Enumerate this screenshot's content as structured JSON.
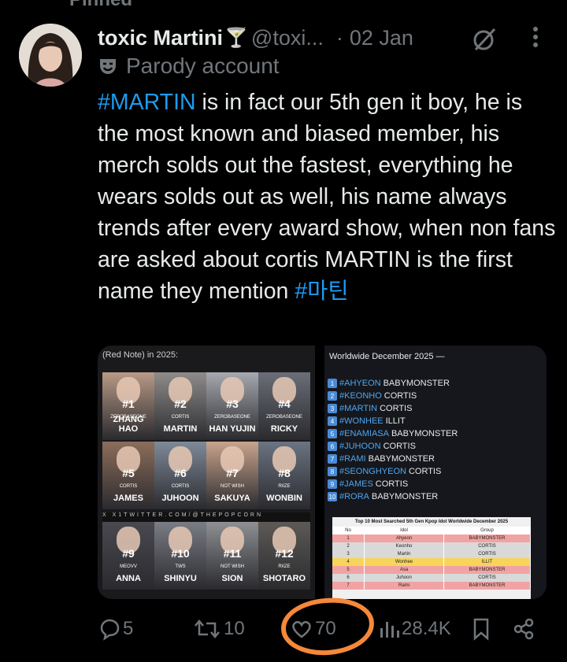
{
  "header_partial": "Pinned",
  "tweet": {
    "author_name": "toxic Martini",
    "author_emoji": "🍸",
    "handle": "@toxi...",
    "separator": "·",
    "date": "02 Jan",
    "parody_label": "Parody account",
    "text_parts": [
      {
        "type": "hashtag",
        "text": "#MARTIN"
      },
      {
        "type": "text",
        "text": " is in fact our 5th gen it boy, he is the most known and biased member, his merch solds out the fastest, everything he wears solds out as well, his name always trends after every award show, when non fans are asked about cortis MARTIN is the first name they mention "
      },
      {
        "type": "hashtag",
        "text": "#마틴"
      }
    ]
  },
  "media_left": {
    "caption": "(Red Note) in 2025:",
    "watermark": "X  X1TWITTER.COM/@THEPOPCORN",
    "cells": [
      {
        "rank": "#1",
        "group": "ZEROBASEONE",
        "idol": "ZHANG HAO",
        "tone": "#b99a86"
      },
      {
        "rank": "#2",
        "group": "CORTIS",
        "idol": "MARTIN",
        "tone": "#8f8c8a"
      },
      {
        "rank": "#3",
        "group": "ZEROBASEONE",
        "idol": "HAN YUJIN",
        "tone": "#a7a9b0"
      },
      {
        "rank": "#4",
        "group": "ZEROBASEONE",
        "idol": "RICKY",
        "tone": "#6a6e78"
      },
      {
        "rank": "#5",
        "group": "CORTIS",
        "idol": "JAMES",
        "tone": "#8d6e5b"
      },
      {
        "rank": "#6",
        "group": "CORTIS",
        "idol": "JUHOON",
        "tone": "#7f8a99"
      },
      {
        "rank": "#7",
        "group": "NOT WISH",
        "idol": "SAKUYA",
        "tone": "#c9a48d"
      },
      {
        "rank": "#8",
        "group": "RIIZE",
        "idol": "WONBIN",
        "tone": "#6b7482"
      },
      {
        "rank": "#9",
        "group": "MEOVV",
        "idol": "ANNA",
        "tone": "#4a4950"
      },
      {
        "rank": "#10",
        "group": "TWS",
        "idol": "SHINYU",
        "tone": "#7b7d85"
      },
      {
        "rank": "#11",
        "group": "NOT WISH",
        "idol": "SION",
        "tone": "#8e9093"
      },
      {
        "rank": "#12",
        "group": "RIIZE",
        "idol": "SHOTARO",
        "tone": "#5d5a56"
      }
    ]
  },
  "media_right": {
    "caption": "Worldwide December 2025 —",
    "ranks": [
      {
        "num": "1",
        "tag": "#AHYEON",
        "group": "BABYMONSTER"
      },
      {
        "num": "2",
        "tag": "#KEONHO",
        "group": "CORTIS"
      },
      {
        "num": "3",
        "tag": "#MARTIN",
        "group": "CORTIS"
      },
      {
        "num": "4",
        "tag": "#WONHEE",
        "group": "ILLIT"
      },
      {
        "num": "5",
        "tag": "#ENAMIASA",
        "group": "BABYMONSTER"
      },
      {
        "num": "6",
        "tag": "#JUHOON",
        "group": "CORTIS"
      },
      {
        "num": "7",
        "tag": "#RAMI",
        "group": "BABYMONSTER"
      },
      {
        "num": "8",
        "tag": "#SEONGHYEON",
        "group": "CORTIS"
      },
      {
        "num": "9",
        "tag": "#JAMES",
        "group": "CORTIS"
      },
      {
        "num": "10",
        "tag": "#RORA",
        "group": "BABYMONSTER"
      }
    ],
    "table": {
      "title": "Top 10 Most Searched 5th Gen Kpop Idol Worldwide December 2025",
      "headers": [
        "No",
        "Idol",
        "Group"
      ],
      "rows": [
        {
          "no": "1",
          "idol": "Ahyeon",
          "group": "BABYMONSTER",
          "color": "#f1a3a3"
        },
        {
          "no": "2",
          "idol": "Keonho",
          "group": "CORTIS",
          "color": "#d9d9d9"
        },
        {
          "no": "3",
          "idol": "Martin",
          "group": "CORTIS",
          "color": "#d9d9d9"
        },
        {
          "no": "4",
          "idol": "Wonhee",
          "group": "ILLIT",
          "color": "#f7d45a"
        },
        {
          "no": "5",
          "idol": "Asa",
          "group": "BABYMONSTER",
          "color": "#f1a3a3"
        },
        {
          "no": "6",
          "idol": "Juhoon",
          "group": "CORTIS",
          "color": "#d9d9d9"
        },
        {
          "no": "7",
          "idol": "Rami",
          "group": "BABYMONSTER",
          "color": "#f1a3a3"
        }
      ]
    }
  },
  "actions": {
    "replies": "5",
    "reposts": "10",
    "likes": "70",
    "views": "28.4K"
  },
  "colors": {
    "background": "#000000",
    "text": "#e7e9ea",
    "muted": "#71767b",
    "accent": "#1d9bf0",
    "annotation": "#f5893a"
  }
}
